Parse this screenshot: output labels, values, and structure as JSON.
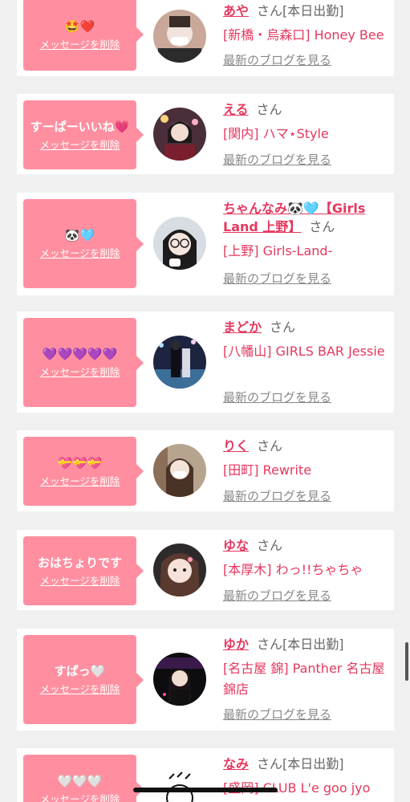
{
  "entries": [
    {
      "message": "🤩❤️",
      "delete_label": "メッセージを削除",
      "name": "あや",
      "honorific": "さん",
      "status": "[本日出勤]",
      "shop": "[新橋・烏森口] Honey Bee",
      "blog_label": "最新のブログを見る"
    },
    {
      "message": "すーぱーいいね💗",
      "delete_label": "メッセージを削除",
      "name": "える",
      "honorific": "さん",
      "status": "",
      "shop": "[関内] ハマ⋆Style",
      "blog_label": "最新のブログを見る"
    },
    {
      "message": "🐼🩵",
      "delete_label": "メッセージを削除",
      "name": "ちゃんなみ🐼🩵【Girls Land 上野】",
      "honorific": "さん",
      "status": "",
      "shop": "[上野] Girls-Land-",
      "blog_label": "最新のブログを見る"
    },
    {
      "message": "💜💜💜💜💜",
      "delete_label": "メッセージを削除",
      "name": "まどか",
      "honorific": "さん",
      "status": "",
      "shop": "[八幡山] GIRLS BAR Jessie",
      "blog_label": "最新のブログを見る"
    },
    {
      "message": "💝💝💝",
      "delete_label": "メッセージを削除",
      "name": "りく",
      "honorific": "さん",
      "status": "",
      "shop": "[田町] Rewrite",
      "blog_label": "最新のブログを見る"
    },
    {
      "message": "おはちょりです",
      "delete_label": "メッセージを削除",
      "name": "ゆな",
      "honorific": "さん",
      "status": "",
      "shop": "[本厚木] わっ!!ちゃちゃ",
      "blog_label": "最新のブログを見る"
    },
    {
      "message": "すぱっ🤍",
      "delete_label": "メッセージを削除",
      "name": "ゆか",
      "honorific": "さん",
      "status": "[本日出勤]",
      "shop": "[名古屋 錦] Panther 名古屋錦店",
      "blog_label": "最新のブログを見る"
    },
    {
      "message": "🤍🤍🤍",
      "delete_label": "メッセージを削除",
      "name": "なみ",
      "honorific": "さん",
      "status": "[本日出勤]",
      "shop": "[盛岡] CLUB L'e goo jyo",
      "blog_label": ""
    }
  ],
  "colors": {
    "accent": "#e5385e",
    "bubble": "#ff8fa0",
    "background": "#f0f0f0"
  }
}
